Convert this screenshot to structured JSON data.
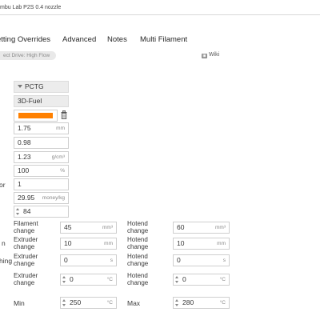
{
  "window": {
    "title": "mbu Lab P2S 0.4 nozzle"
  },
  "tabs": [
    {
      "label": "etting Overrides"
    },
    {
      "label": "Advanced"
    },
    {
      "label": "Notes"
    },
    {
      "label": "Multi Filament"
    }
  ],
  "badge": {
    "label": "ect Drive: High Flow"
  },
  "wiki": {
    "label": "Wiki"
  },
  "filament": {
    "type": "PCTG",
    "vendor": "3D-Fuel",
    "color_hex": "#FF8000",
    "fields": [
      {
        "value": "1.75",
        "unit": "mm"
      },
      {
        "value": "0.98",
        "unit": ""
      },
      {
        "value": "1.23",
        "unit": "g/cm³"
      },
      {
        "value": "100",
        "unit": "%"
      },
      {
        "value": "1",
        "unit": ""
      },
      {
        "value": "29.95",
        "unit": "money/kg"
      },
      {
        "value": "84",
        "unit": ""
      }
    ],
    "cut_labels": {
      "or": "or",
      "n": "n",
      "hing": "hing"
    }
  },
  "multi": {
    "rows": [
      {
        "left_label": "Filament change",
        "left_value": "45",
        "left_unit": "mm³",
        "right_label": "Hotend change",
        "right_value": "60",
        "right_unit": "mm³"
      },
      {
        "left_label": "Extruder change",
        "left_value": "10",
        "left_unit": "mm",
        "right_label": "Hotend change",
        "right_value": "10",
        "right_unit": "mm"
      },
      {
        "left_label": "Extruder change",
        "left_value": "0",
        "left_unit": "s",
        "right_label": "Hotend change",
        "right_value": "0",
        "right_unit": "s"
      },
      {
        "left_label": "Extruder change",
        "left_value": "0",
        "left_unit": "°C",
        "right_label": "Hotend change",
        "right_value": "0",
        "right_unit": "°C"
      }
    ],
    "min_label": "Min",
    "min_value": "250",
    "min_unit": "°C",
    "max_label": "Max",
    "max_value": "280",
    "max_unit": "°C"
  },
  "icons": {
    "trash": "trash-icon",
    "wiki": "wiki-icon",
    "dropdown": "chevron-down-icon",
    "spinner": "spinner-arrows-icon"
  },
  "colors": {
    "accent": "#FF8000",
    "tab_text": "#262626",
    "border": "#CFCFCF"
  }
}
